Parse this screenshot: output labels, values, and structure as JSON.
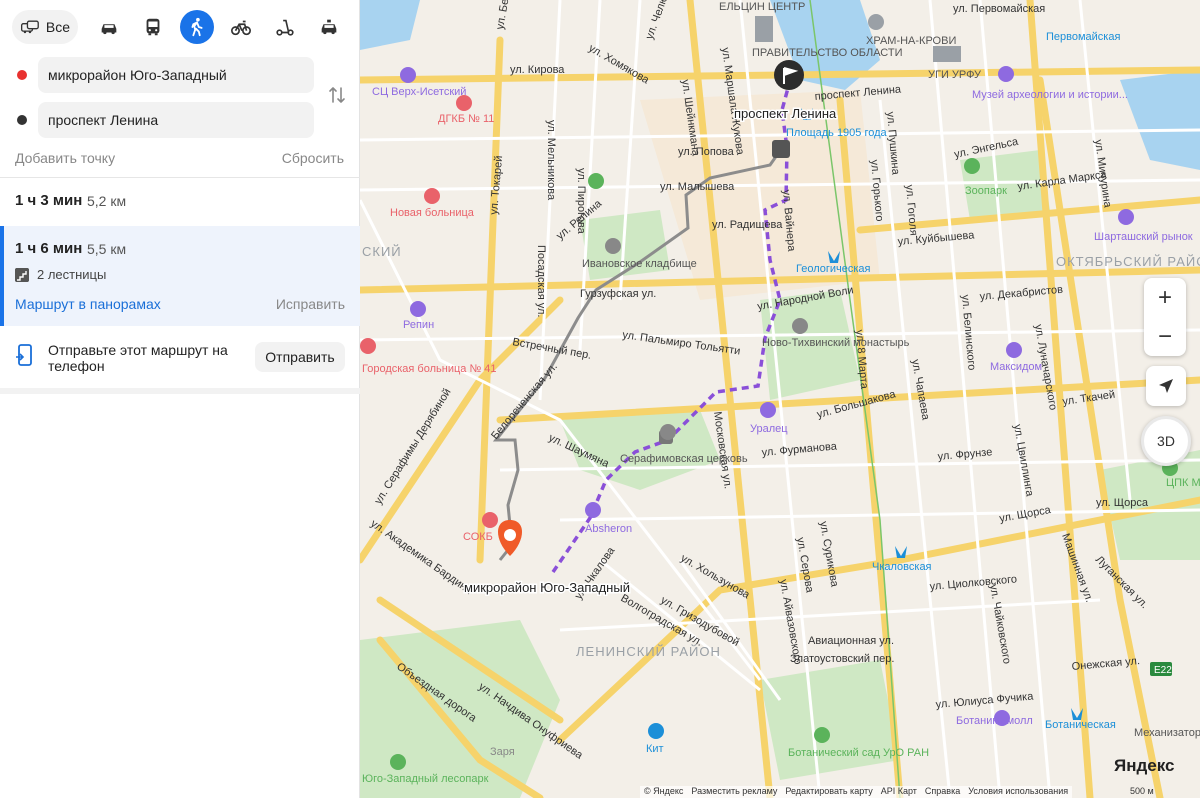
{
  "modes": {
    "all_label": "Все",
    "items": [
      "car-icon",
      "bus-icon",
      "walk-icon",
      "bicycle-icon",
      "scooter-icon",
      "taxi-icon"
    ],
    "active": "walk-icon",
    "accent": "#1a73e8"
  },
  "route": {
    "from": "микрорайон Юго-Западный",
    "to": "проспект Ленина",
    "from_color": "#e8312f",
    "to_color": "#333333",
    "add_point": "Добавить точку",
    "reset": "Сбросить"
  },
  "routes": [
    {
      "time": "1 ч 3 мин",
      "distance": "5,2 км"
    },
    {
      "time": "1 ч 6 мин",
      "distance": "5,5 км",
      "stairs": "2 лестницы",
      "panorama": "Маршрут в панорамах",
      "fix": "Исправить"
    }
  ],
  "send": {
    "text": "Отправьте этот маршрут на телефон",
    "button": "Отправить"
  },
  "map": {
    "streets": [
      "ул. Челюскинцев",
      "ул. Хомякова",
      "ул. Бебеля",
      "ул. Кирова",
      "ул. Шейнкмана",
      "ул. Маршала Жукова",
      "ул. Попова",
      "ул. Мельникова",
      "ул. Пирогова",
      "ул. Репина",
      "ул. Малышева",
      "ул. Токарей",
      "ул. Радищева",
      "Посадская ул.",
      "Гурзуфская ул.",
      "ул. Пальмиро Тольятти",
      "Встречный пер.",
      "Белореченская ул.",
      "ул. Шаумяна",
      "ул. Серафимы Дерябиной",
      "ул. Академика Бардина",
      "ул. Чкалова",
      "Волгоградская ул.",
      "ул. Гризодубовой",
      "ул. Хользунова",
      "Московская ул.",
      "ул. Фурманова",
      "ул. Большакова",
      "ул. Ткачей",
      "ул. Куйбышева",
      "ул. Декабристов",
      "ул. Щорса",
      "ул. Циолковского",
      "Авиационная ул.",
      "Златоустовский пер.",
      "ул. Юлиуса Фучика",
      "ул. 8 Марта",
      "ул. Белинского",
      "ул. Луначарского",
      "ул. Мичурина",
      "ул. Энгельса",
      "ул. Карла Маркса",
      "ул. Пушкина",
      "ул. Горького",
      "ул. Гоголя",
      "ул. Чапаева",
      "ул. Фрунзе",
      "ул. Сурикова",
      "ул. Серова",
      "ул. Айвазовского",
      "Машинная ул.",
      "Луганская ул.",
      "Онежская ул.",
      "Объездная дорога",
      "ул. Начдива Онуфриева",
      "ул. Народной Воли",
      "проспект Ленина",
      "ул. Первомайская",
      "ул. Чайковского",
      "ул. Цвиллинга",
      "ул. Вайнера",
      "ул. Щорса"
    ],
    "pois": [
      "ЕЛЬЦИН ЦЕНТР",
      "ПРАВИТЕЛЬСТВО ОБЛАСТИ",
      "ХРАМ-НА-КРОВИ",
      "УГИ УРФУ",
      "Музей археологии и истории...",
      "Первомайская",
      "СЦ Верх-Исетский",
      "ДГКБ № 11",
      "Площадь 1905 года",
      "Зоопарк",
      "Новая больница",
      "Ивановское кладбище",
      "Шарташский рынок",
      "Геологическая",
      "Ново-Тихвинский монастырь",
      "Репин",
      "Городская больница № 41",
      "Максидом",
      "Уралец",
      "Серафимовская церковь",
      "Absheron",
      "СОКБ",
      "Чкаловская",
      "Ботаника молл",
      "Ботаническая",
      "Ботанический сад УрО РАН",
      "Кит",
      "Заря",
      "Юго-Западный лесопарк",
      "ЦПК Маяковского",
      "Механизатор"
    ],
    "districts": [
      "ОКТЯБРЬСКИЙ РАЙОН",
      "ЛЕНИНСКИЙ РАЙОН",
      "СКИЙ"
    ],
    "labels": {
      "start": "микрорайон Юго-Западный",
      "end": "проспект Ленина"
    },
    "route_color": "#8a4fd8",
    "alt_route_color": "#8c8c8c",
    "badge": "E22"
  },
  "controls": {
    "zoom_in": "+",
    "zoom_out": "−",
    "three_d": "3D"
  },
  "footer": {
    "items": [
      "© Яндекс",
      "Разместить рекламу",
      "Редактировать карту",
      "API Карт",
      "Справка",
      "Условия использования"
    ],
    "scale": "500 м",
    "logo": "Яндекс"
  }
}
